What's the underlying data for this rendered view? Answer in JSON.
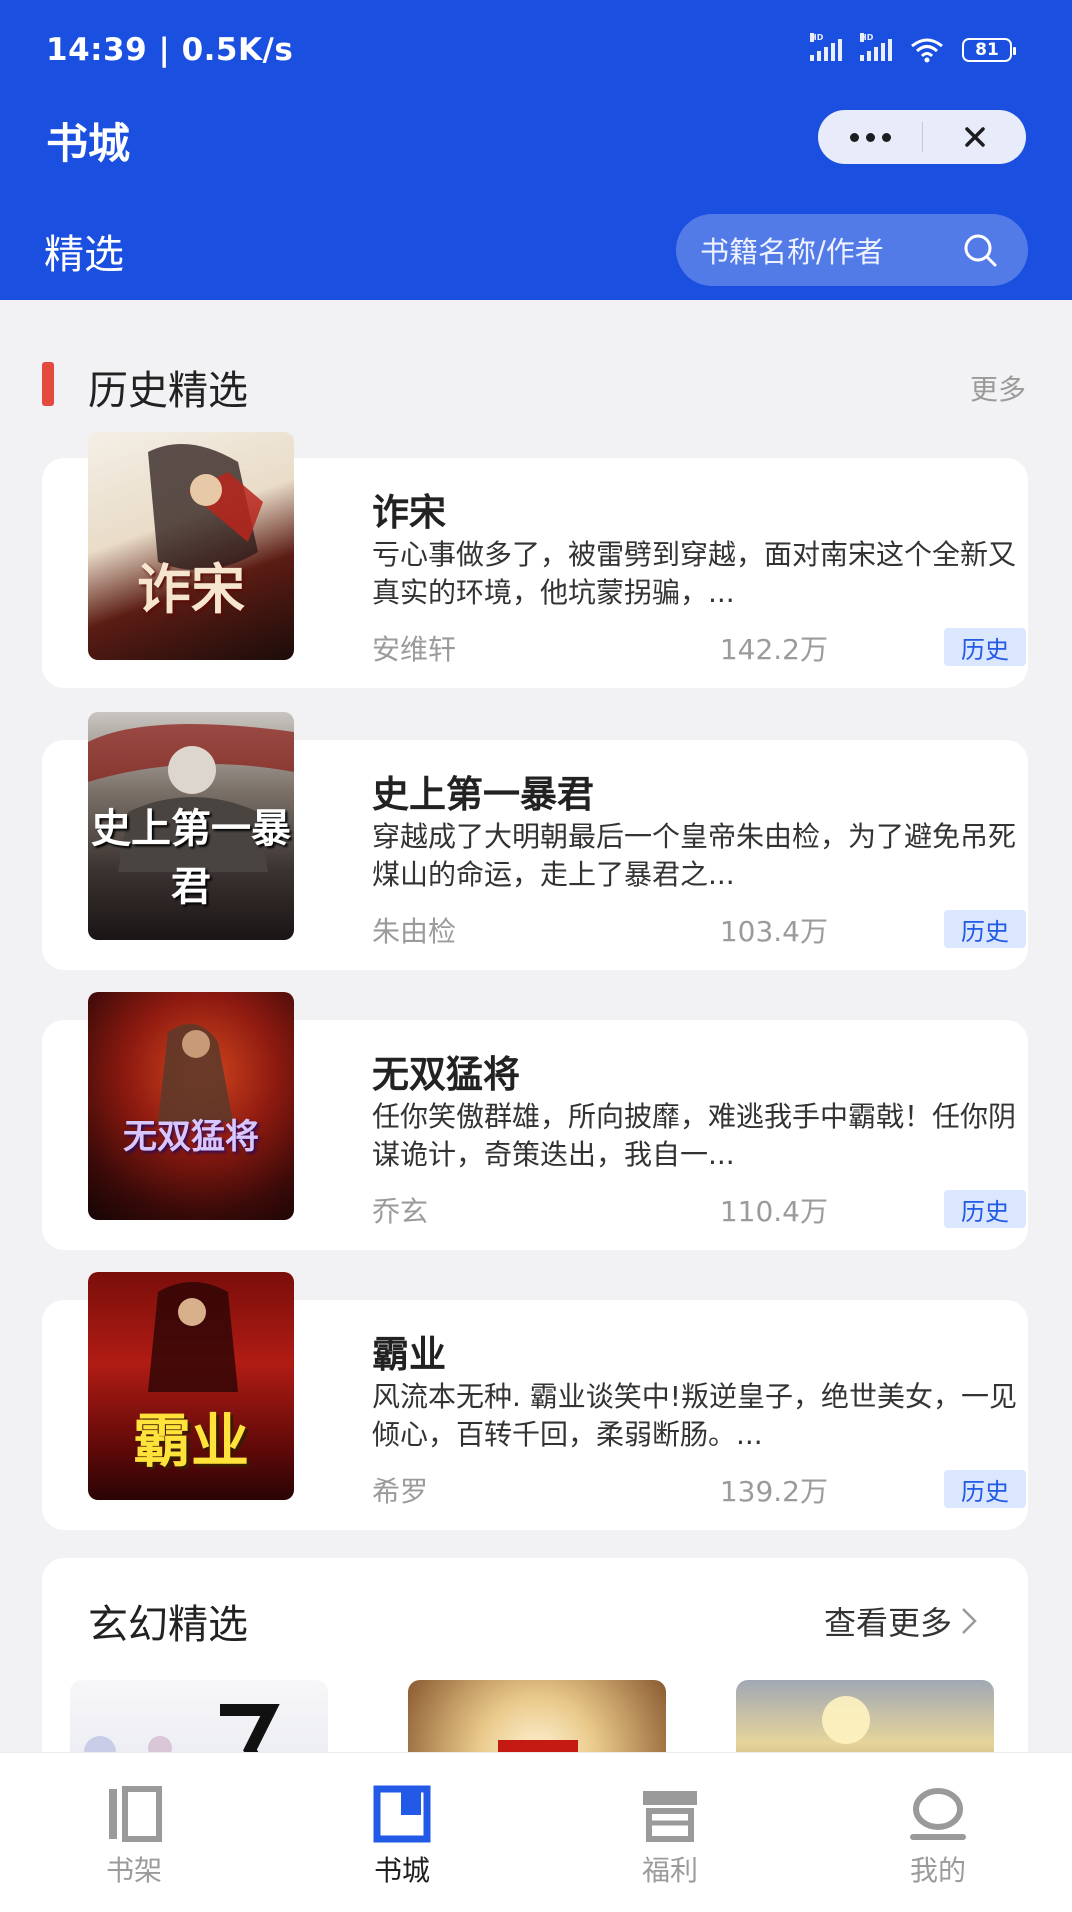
{
  "status": {
    "time": "14:39 | 0.5K/s",
    "battery": "81"
  },
  "header": {
    "title": "书城",
    "tab": "精选",
    "search_placeholder": "书籍名称/作者"
  },
  "section1": {
    "title": "历史精选",
    "more": "更多",
    "books": [
      {
        "title": "诈宋",
        "cover_text": "诈宋",
        "desc": "亏心事做多了，被雷劈到穿越，面对南宋这个全新又真实的环境，他坑蒙拐骗，...",
        "author": "安维轩",
        "count": "142.2万",
        "tag": "历史"
      },
      {
        "title": "史上第一暴君",
        "cover_text": "史上第一暴君",
        "desc": "穿越成了大明朝最后一个皇帝朱由检，为了避免吊死煤山的命运，走上了暴君之...",
        "author": "朱由检",
        "count": "103.4万",
        "tag": "历史"
      },
      {
        "title": "无双猛将",
        "cover_text": "无双猛将",
        "desc": "任你笑傲群雄，所向披靡，难逃我手中霸戟！任你阴谋诡计，奇策迭出，我自一...",
        "author": "乔玄",
        "count": "110.4万",
        "tag": "历史"
      },
      {
        "title": "霸业",
        "cover_text": "霸业",
        "desc": "风流本无种. 霸业谈笑中!叛逆皇子，绝世美女，一见倾心，百转千回，柔弱断肠。...",
        "author": "希罗",
        "count": "139.2万",
        "tag": "历史"
      }
    ]
  },
  "section2": {
    "title": "玄幻精选",
    "more": "查看更多"
  },
  "tabbar": {
    "items": [
      {
        "label": "书架",
        "icon": "bookshelf-icon"
      },
      {
        "label": "书城",
        "icon": "bookstore-icon"
      },
      {
        "label": "福利",
        "icon": "gift-icon"
      },
      {
        "label": "我的",
        "icon": "profile-icon"
      }
    ],
    "active_index": 1
  },
  "colors": {
    "brand": "#1a4fe0",
    "accent_red": "#e44a3c",
    "tag_bg": "#dbe6ff",
    "tag_text": "#2259e6"
  }
}
